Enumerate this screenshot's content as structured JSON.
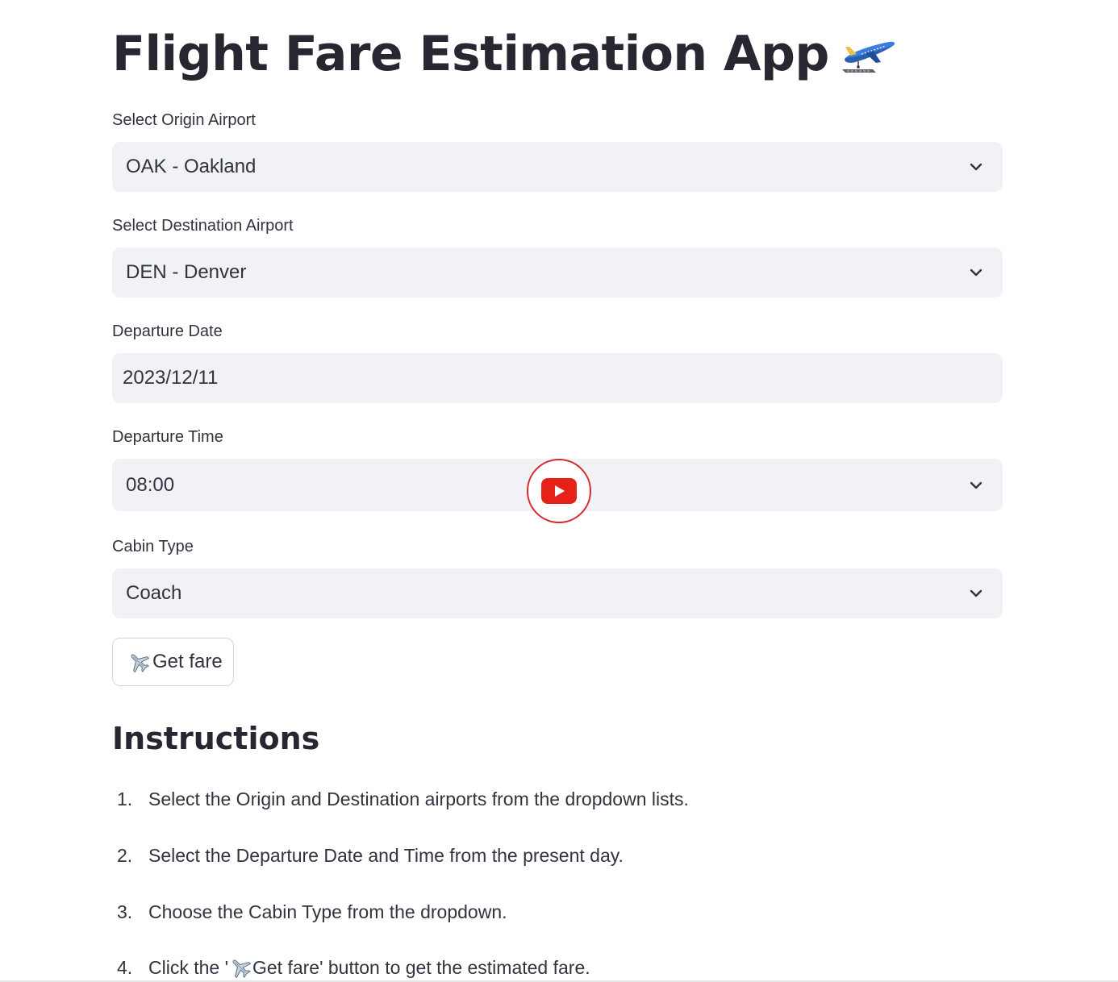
{
  "app": {
    "title": "Flight Fare Estimation App"
  },
  "form": {
    "origin": {
      "label": "Select Origin Airport",
      "value": "OAK - Oakland"
    },
    "destination": {
      "label": "Select Destination Airport",
      "value": "DEN - Denver"
    },
    "departure_date": {
      "label": "Departure Date",
      "value": "2023/12/11"
    },
    "departure_time": {
      "label": "Departure Time",
      "value": "08:00"
    },
    "cabin_type": {
      "label": "Cabin Type",
      "value": "Coach"
    },
    "submit": {
      "label": "Get fare",
      "icon": "airplane-icon"
    }
  },
  "instructions": {
    "heading": "Instructions",
    "steps": [
      {
        "num": "1.",
        "text": "Select the Origin and Destination airports from the dropdown lists."
      },
      {
        "num": "2.",
        "text": "Select the Departure Date and Time from the present day."
      },
      {
        "num": "3.",
        "text": "Choose the Cabin Type from the dropdown."
      },
      {
        "num": "4.",
        "text_before": "Click the '",
        "text_after": "Get fare' button to get the estimated fare."
      }
    ]
  },
  "overlay": {
    "icon": "youtube-play-icon"
  },
  "colors": {
    "field_bg": "#f0f2f6",
    "text": "#31333f",
    "heading": "#262730",
    "youtube_red": "#e62117",
    "overlay_ring": "#d9272e"
  }
}
